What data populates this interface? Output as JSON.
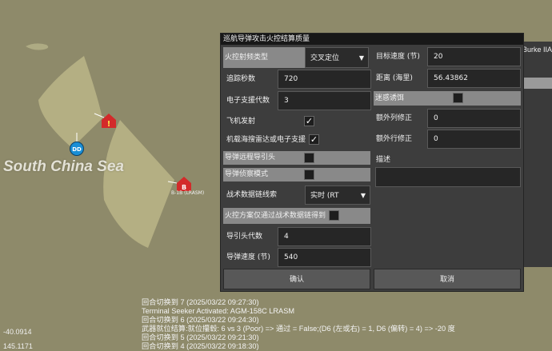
{
  "map": {
    "sea_label": "South China Sea",
    "unit_dd_label": "DD",
    "unit_b_letter": "B",
    "unit_b_label": "B-1B (LRASM)",
    "unit_alert_glyph": "!",
    "coord_1": "-40.0914",
    "coord_2": "145.1171"
  },
  "background_panel": {
    "partial_text": "Burke IIA",
    "partial_text_2": "A"
  },
  "dialog": {
    "title": "巡航导弹攻击火控结算质量",
    "left": {
      "fire_control_type_label": "火控射频类型",
      "fire_control_type_value": "交叉定位",
      "tracking_seconds_label": "追踪秒数",
      "tracking_seconds_value": "720",
      "esm_generation_label": "电子支援代数",
      "esm_generation_value": "3",
      "aircraft_launch_label": "飞机发射",
      "aircraft_launch_checked": true,
      "airborne_radar_label": "机载海搜雷达或电子支援",
      "airborne_radar_checked": true,
      "missile_remote_seeker_label": "导弹远程导引头",
      "missile_remote_seeker_checked": false,
      "missile_recon_mode_label": "导弹侦察模式",
      "missile_recon_mode_checked": false,
      "tactical_datalink_label": "战术数据链线索",
      "tactical_datalink_value": "实时 (RT",
      "datalink_only_label": "火控方案仅通过战术数据链得到",
      "datalink_only_checked": false,
      "seeker_generation_label": "导引头代数",
      "seeker_generation_value": "4",
      "missile_speed_label": "导弹速度 (节)",
      "missile_speed_value": "540"
    },
    "right": {
      "target_speed_label": "目标速度 (节)",
      "target_speed_value": "20",
      "distance_label": "距离 (海里)",
      "distance_value": "56.43862",
      "decoy_label": "迷惑诱饵",
      "decoy_checked": false,
      "extra_column_label": "额外列修正",
      "extra_column_value": "0",
      "extra_row_label": "额外行修正",
      "extra_row_value": "0",
      "description_label": "描述",
      "description_value": ""
    },
    "confirm_label": "确认",
    "cancel_label": "取消"
  },
  "log": [
    "回合切换到 7 (2025/03/22 09:27:30)",
    "Terminal Seeker Activated: AGM-158C LRASM",
    "回合切换到 6 (2025/03/22 09:24:30)",
    "武器就位结算:就位攥毂: 6 vs 3 (Poor) => 通过 = False;(D6 (左或右) = 1, D6 (偏转) = 4) => -20 度",
    "回合切换到 5 (2025/03/22 09:21:30)",
    "回合切换到 4 (2025/03/22 09:18:30)"
  ],
  "colors": {
    "map_background": "#8e8a6a",
    "range_fan": "#b8b286",
    "unit_red": "#d32a2a",
    "unit_blue": "#1a8fd6",
    "dialog_bg": "#3d3d3d",
    "highlight_row": "#898989"
  }
}
